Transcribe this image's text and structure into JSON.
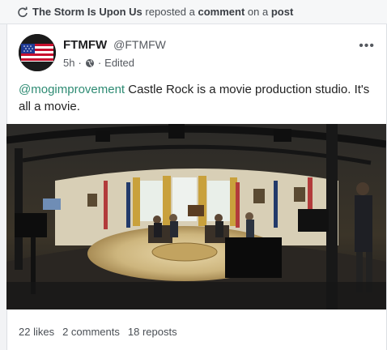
{
  "repost_bar": {
    "icon": "repost-icon",
    "user": "The Storm Is Upon Us",
    "action_1": "reposted a",
    "object": "comment",
    "action_2": "on a",
    "target": "post"
  },
  "post": {
    "author_name": "FTMFW",
    "author_handle": "@FTMFW",
    "time": "5h",
    "visibility_icon": "globe-icon",
    "edited": "Edited",
    "more_label": "•••",
    "mention": "@mogimprovement",
    "text": " Castle Rock is a movie production studio. It's all a movie.",
    "image_alt": "Film set recreating the Oval Office with cameras and lighting rigs"
  },
  "stats": {
    "likes": "22 likes",
    "comments": "2 comments",
    "reposts": "18 reposts"
  },
  "colors": {
    "mention": "#2e8b73",
    "background": "#f2f3f5"
  }
}
